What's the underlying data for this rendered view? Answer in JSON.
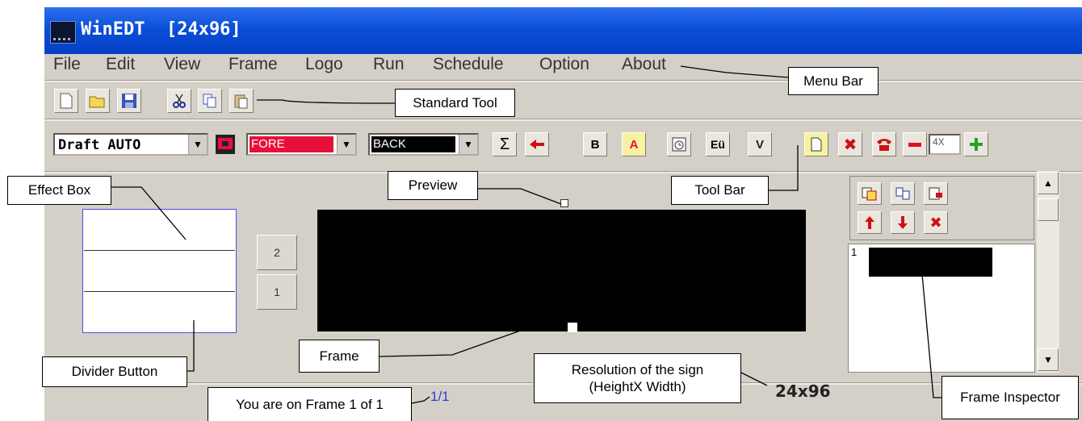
{
  "window": {
    "title": "WinEDT  [24x96]"
  },
  "menu": {
    "items": [
      "File",
      "Edit",
      "View",
      "Frame",
      "Logo",
      "Run",
      "Schedule",
      "Option",
      "About"
    ]
  },
  "toolbar": {
    "font_select": "Draft AUTO",
    "fore_select": "FORE",
    "back_select": "BACK",
    "sigma_label": "Σ",
    "bold_label": "B",
    "a_label": "A",
    "eu_label": "Eü",
    "v_label": "V",
    "zoom_value": "4X",
    "fore_color": "#e8103a",
    "back_color": "#000000"
  },
  "divider_buttons": [
    "2",
    "1"
  ],
  "frame_inspector": {
    "first_index": "1"
  },
  "status": {
    "frame_counter": "1/1",
    "resolution": "24x96"
  },
  "annotations": {
    "menu_bar": "Menu Bar",
    "standard_tool": "Standard Tool",
    "effect_box": "Effect Box",
    "preview": "Preview",
    "tool_bar": "Tool Bar",
    "divider_button": "Divider Button",
    "frame": "Frame",
    "resolution_line1": "Resolution of the sign",
    "resolution_line2": "(HeightX Width)",
    "frame_position": "You are on Frame 1 of 1",
    "frame_inspector": "Frame Inspector"
  }
}
